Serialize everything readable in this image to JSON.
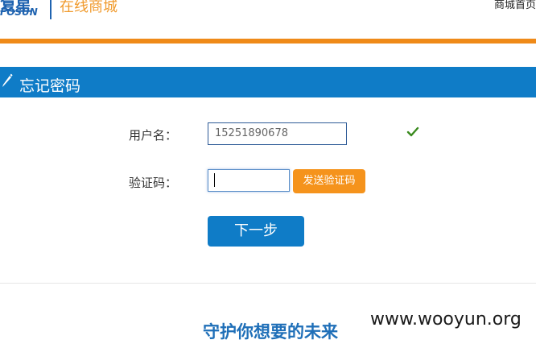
{
  "header": {
    "logo_cn": "复星",
    "logo_en": "FOSUN",
    "title": "在线商城",
    "home_link": "商城首页"
  },
  "section": {
    "title": "忘记密码"
  },
  "form": {
    "username_label": "用户名：",
    "username_value": "15251890678",
    "code_label": "验证码：",
    "code_value": "",
    "send_code_label": "发送验证码",
    "next_label": "下一步"
  },
  "footer": {
    "slogan": "守护你想要的未来",
    "watermark": "www.wooyun.org"
  },
  "colors": {
    "brand_blue": "#0f7cc7",
    "accent_orange": "#ef8a19",
    "button_orange": "#f5931c",
    "check_green": "#3a8a1e"
  }
}
